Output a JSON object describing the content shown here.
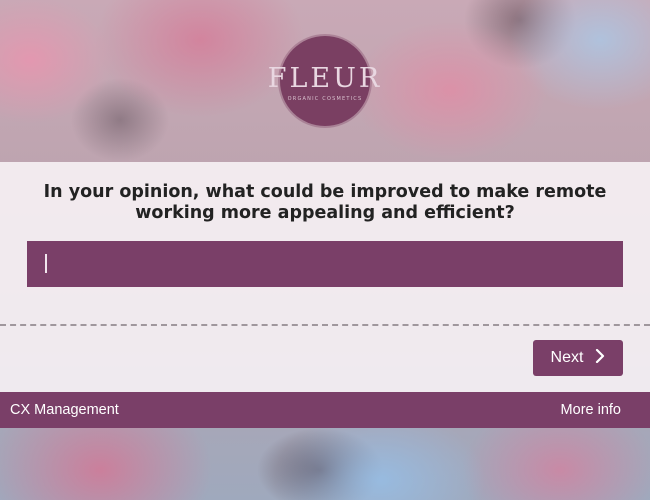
{
  "logo": {
    "word": "FLEUR",
    "tagline": "ORGANIC COSMETICS"
  },
  "question": {
    "line1": "In your opinion, what could be improved to make remote",
    "line2": "working more appealing and efficient?"
  },
  "answer": {
    "value": "",
    "placeholder": ""
  },
  "next_button": {
    "label": "Next",
    "icon": "chevron-right-icon"
  },
  "footer": {
    "left_text": "CX Management",
    "right_link": "More info"
  },
  "colors": {
    "brand": "#7a3f68",
    "panel": "#faf6f8",
    "text": "#222222"
  }
}
